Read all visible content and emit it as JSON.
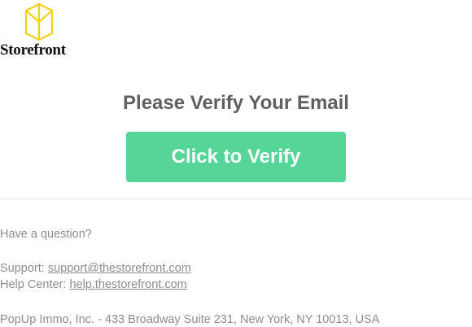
{
  "logo": {
    "wordmark": "Storefront",
    "mark_color": "#f2d21b"
  },
  "title": "Please Verify Your Email",
  "verify_button": {
    "label": "Click to Verify",
    "color": "#55d698"
  },
  "footer": {
    "question": "Have a question?",
    "support_label": "Support:",
    "support_email": "support@thestorefront.com",
    "help_label": "Help Center:",
    "help_link": "help.thestorefront.com",
    "address": "PopUp Immo, Inc. - 433 Broadway Suite 231, New York, NY 10013, USA"
  }
}
